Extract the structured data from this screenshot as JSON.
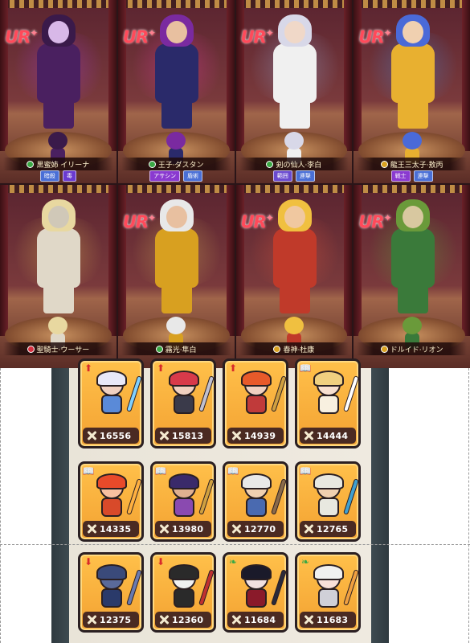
{
  "colors": {
    "ur_badge": "#ff4a5a",
    "card_gold": "#f3a232",
    "element_green": "#3aa845",
    "element_gold": "#d8a020",
    "element_red": "#d83040"
  },
  "heroes": [
    {
      "rarity": "UR",
      "name": "黒蜜姉 イリーナ",
      "element": "element_green",
      "tags": [
        {
          "label": "暗殺",
          "color": "#4a6fd6"
        },
        {
          "label": "毒",
          "color": "#6a3ad0"
        }
      ],
      "hair": "#3a1a4a",
      "body": "#4a2060",
      "aura": "#b040ff",
      "skin": "#d8b8e8"
    },
    {
      "rarity": "UR",
      "name": "王子·ダスタン",
      "element": "element_green",
      "tags": [
        {
          "label": "アサシン",
          "color": "#8a3ad0"
        },
        {
          "label": "盾術",
          "color": "#4a6fd6"
        }
      ],
      "hair": "#7a2aa0",
      "body": "#2a2a6a",
      "aura": "#ff40c0",
      "skin": "#e8c0a0"
    },
    {
      "rarity": "UR",
      "name": "剣の仙人·李白",
      "element": "element_green",
      "tags": [
        {
          "label": "範囲",
          "color": "#6a4ad0"
        },
        {
          "label": "連撃",
          "color": "#4a6fd6"
        }
      ],
      "hair": "#d8d8e8",
      "body": "#f0f0f0",
      "aura": "#a0c8ff",
      "skin": "#f0d8c8"
    },
    {
      "rarity": "UR",
      "name": "龍王三太子·敖丙",
      "element": "element_gold",
      "tags": [
        {
          "label": "戦士",
          "color": "#8a3ad0"
        },
        {
          "label": "連撃",
          "color": "#4a6fd6"
        }
      ],
      "hair": "#4a6ad8",
      "body": "#e8b030",
      "aura": "#40a0ff",
      "skin": "#f0d0b0"
    },
    {
      "rarity": "",
      "name": "聖騎士·ウーサー",
      "element": "element_red",
      "tags": [],
      "hair": "#e8d8a0",
      "body": "#e0d8c8",
      "aura": "#ffd860",
      "skin": "#d0c8b8"
    },
    {
      "rarity": "UR",
      "name": "霧光·隼白",
      "element": "element_green",
      "tags": [],
      "hair": "#e8e8e8",
      "body": "#d8a020",
      "aura": "#f0d060",
      "skin": "#e8c0a0"
    },
    {
      "rarity": "UR",
      "name": "春神·杜康",
      "element": "element_gold",
      "tags": [],
      "hair": "#f0c040",
      "body": "#c03a2a",
      "aura": "#ff6040",
      "skin": "#f0c8a0"
    },
    {
      "rarity": "UR",
      "name": "ドルイド·リオン",
      "element": "element_gold",
      "tags": [],
      "hair": "#6a9a3a",
      "body": "#3a7a3a",
      "aura": "#60c040",
      "skin": "#d8c8a0"
    }
  ],
  "cards": [
    {
      "power": "16556",
      "corner": "arrow-up",
      "hair": "#e8e8f8",
      "skin": "#f0d0c0",
      "body": "#5a8ad8",
      "prop": "#80d0ff"
    },
    {
      "power": "15813",
      "corner": "arrow-up",
      "hair": "#d83a4a",
      "skin": "#f0d0c0",
      "body": "#3a3a4a",
      "prop": "#c0c0d0"
    },
    {
      "power": "14939",
      "corner": "arrow-up",
      "hair": "#e85a2a",
      "skin": "#f0d0c0",
      "body": "#c03a3a",
      "prop": "#d0a040"
    },
    {
      "power": "14444",
      "corner": "book",
      "hair": "#f0d080",
      "skin": "#f8e0d0",
      "body": "#f8f0e0",
      "prop": "#ffffff"
    },
    {
      "power": "14335",
      "corner": "book",
      "hair": "#e84a2a",
      "skin": "#f8c0a0",
      "body": "#d84a2a",
      "prop": "#ffb040"
    },
    {
      "power": "13980",
      "corner": "book",
      "hair": "#3a2a6a",
      "skin": "#e0b090",
      "body": "#8a4ab0",
      "prop": "#d0a040"
    },
    {
      "power": "12770",
      "corner": "book",
      "hair": "#e8e8e8",
      "skin": "#f0d0b0",
      "body": "#4a6ab0",
      "prop": "#8a6a4a"
    },
    {
      "power": "12765",
      "corner": "book",
      "hair": "#e8e8e0",
      "skin": "#f0d0b0",
      "body": "#e8e8e0",
      "prop": "#40a0d0"
    },
    {
      "power": "12375",
      "corner": "arrow-down",
      "hair": "#3a4a7a",
      "skin": "#5a6a9a",
      "body": "#2a3a6a",
      "prop": "#6a7ab0"
    },
    {
      "power": "12360",
      "corner": "arrow-down",
      "hair": "#2a2a2a",
      "skin": "#f0f0f0",
      "body": "#2a2a2a",
      "prop": "#c03030"
    },
    {
      "power": "11684",
      "corner": "leaf",
      "hair": "#1a1a2a",
      "skin": "#f0e0e0",
      "body": "#8a1a2a",
      "prop": "#2a2a3a"
    },
    {
      "power": "11683",
      "corner": "leaf",
      "hair": "#f0f0f0",
      "skin": "#f8e0d8",
      "body": "#d0d0d8",
      "prop": "#f0a040"
    }
  ],
  "icons": {
    "power": "crossed-swords-icon",
    "arrow-up": "class-arrow-up-icon",
    "arrow-down": "class-arrow-down-icon",
    "book": "class-book-icon",
    "leaf": "class-leaf-icon"
  }
}
